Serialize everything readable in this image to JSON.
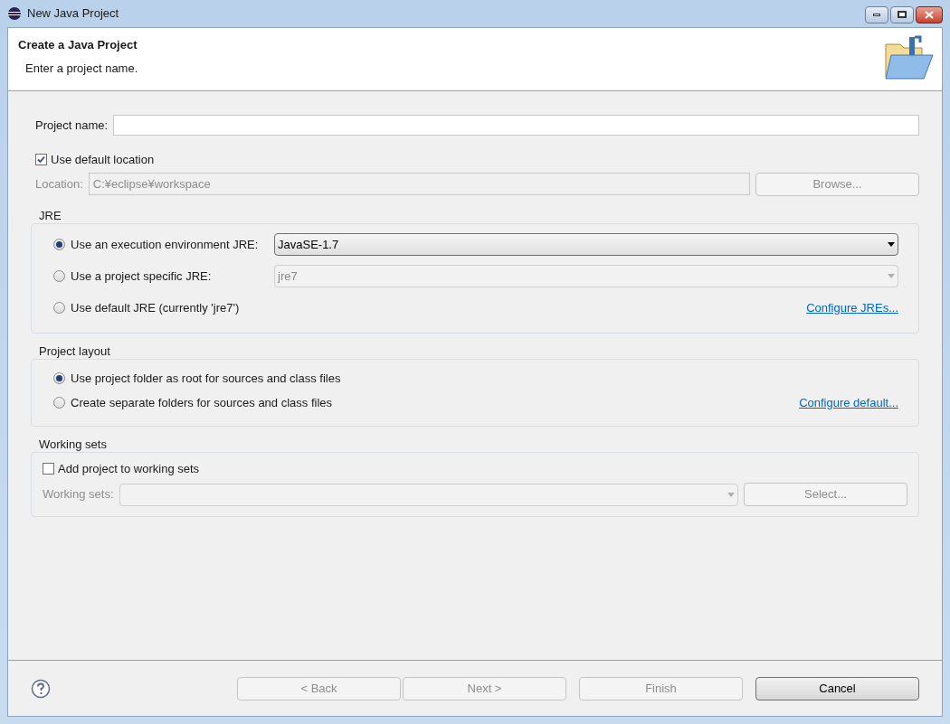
{
  "window": {
    "title": "New Java Project"
  },
  "header": {
    "title": "Create a Java Project",
    "message": "Enter a project name."
  },
  "project_name": {
    "label": "Project name:"
  },
  "default_location": {
    "label": "Use default location",
    "checked": true
  },
  "location": {
    "label": "Location:",
    "value": "C:¥eclipse¥workspace",
    "disabled": true,
    "button": "Browse..."
  },
  "jre": {
    "title": "JRE",
    "options": [
      {
        "label": "Use an execution environment JRE:",
        "selected": true,
        "kind": "combo",
        "value": "JavaSE-1.7",
        "disabled": false
      },
      {
        "label": "Use a project specific JRE:",
        "selected": false,
        "kind": "combo",
        "value": "jre7",
        "disabled": true
      },
      {
        "label": "Use default JRE (currently 'jre7')",
        "selected": false,
        "kind": "link",
        "link": "Configure JREs..."
      }
    ]
  },
  "layout": {
    "title": "Project layout",
    "options": [
      {
        "label": "Use project folder as root for sources and class files",
        "selected": true,
        "kind": "plain"
      },
      {
        "label": "Create separate folders for sources and class files",
        "selected": false,
        "kind": "link",
        "link": "Configure default..."
      }
    ]
  },
  "working_sets": {
    "title": "Working sets",
    "checkbox": {
      "label": "Add project to working sets",
      "checked": false
    },
    "label": "Working sets:",
    "disabled": true,
    "button": "Select..."
  },
  "buttons": [
    {
      "label": "< Back",
      "disabled": true
    },
    {
      "label": "Next >",
      "disabled": true
    },
    {
      "label": "Finish",
      "disabled": true
    },
    {
      "label": "Cancel",
      "disabled": false
    }
  ]
}
